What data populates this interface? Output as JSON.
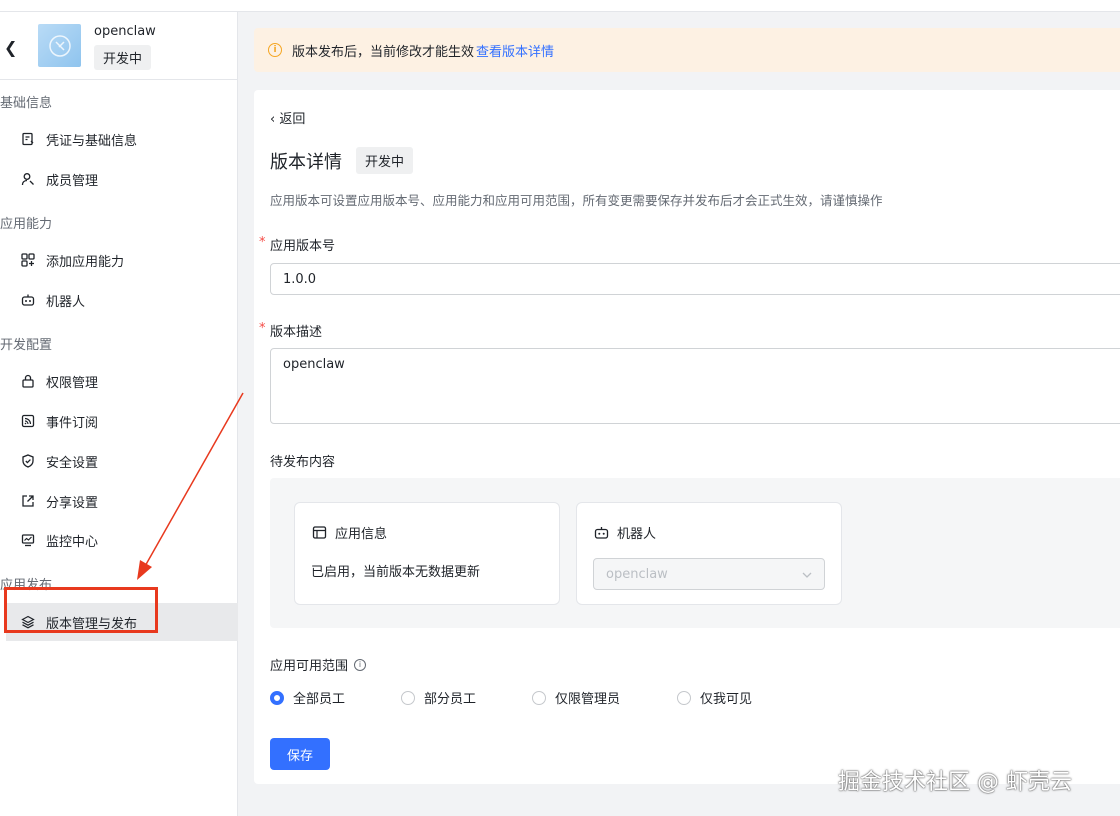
{
  "app": {
    "name": "openclaw",
    "status": "开发中"
  },
  "sidebar": {
    "groups": [
      {
        "title": "基础信息",
        "items": [
          {
            "label": "凭证与基础信息"
          },
          {
            "label": "成员管理"
          }
        ]
      },
      {
        "title": "应用能力",
        "items": [
          {
            "label": "添加应用能力"
          },
          {
            "label": "机器人"
          }
        ]
      },
      {
        "title": "开发配置",
        "items": [
          {
            "label": "权限管理"
          },
          {
            "label": "事件订阅"
          },
          {
            "label": "安全设置"
          },
          {
            "label": "分享设置"
          },
          {
            "label": "监控中心"
          }
        ]
      },
      {
        "title": "应用发布",
        "items": [
          {
            "label": "版本管理与发布"
          }
        ]
      }
    ]
  },
  "notice": {
    "text": "版本发布后，当前修改才能生效",
    "link": "查看版本详情"
  },
  "detail": {
    "back": "返回",
    "title": "版本详情",
    "badge": "开发中",
    "desc": "应用版本可设置应用版本号、应用能力和应用可用范围，所有变更需要保存并发布后才会正式生效，请谨慎操作",
    "version_label": "应用版本号",
    "version_value": "1.0.0",
    "desc_label": "版本描述",
    "desc_value": "openclaw",
    "pending_label": "待发布内容",
    "pending": {
      "app_info": {
        "title": "应用信息",
        "body": "已启用，当前版本无数据更新"
      },
      "bot": {
        "title": "机器人",
        "select_value": "openclaw"
      }
    },
    "scope_label": "应用可用范围",
    "scope_options": [
      {
        "label": "全部员工"
      },
      {
        "label": "部分员工"
      },
      {
        "label": "仅限管理员"
      },
      {
        "label": "仅我可见"
      }
    ],
    "scope_selected": "全部员工",
    "save_label": "保存"
  },
  "watermark": "掘金技术社区 @ 虾壳云",
  "colors": {
    "accent": "#3370ff",
    "annotation": "#e8391e",
    "notice_bg": "#fdf1e3"
  }
}
